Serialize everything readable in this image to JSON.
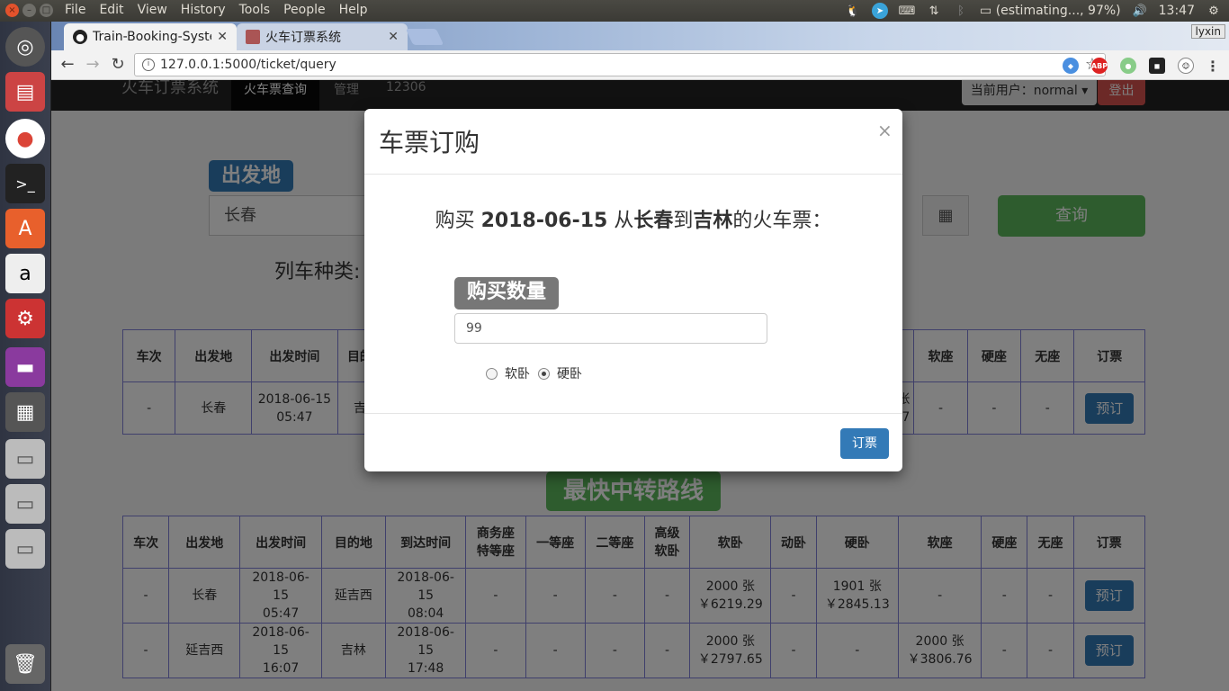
{
  "os": {
    "menu": [
      "File",
      "Edit",
      "View",
      "History",
      "Tools",
      "People",
      "Help"
    ],
    "battery": "(estimating..., 97%)",
    "clock": "13:47"
  },
  "browser": {
    "tabs": [
      {
        "title": "Train-Booking-Syste"
      },
      {
        "title": "火车订票系统"
      }
    ],
    "profile": "lyxin",
    "url": "127.0.0.1:5000/ticket/query"
  },
  "page": {
    "brand": "火车订票系统",
    "nav": {
      "query": "火车票查询",
      "admin": "管理",
      "site12306": "12306"
    },
    "user_label": "当前用户：normal ▾",
    "logout": "登出",
    "depart_label": "出发地",
    "depart_value": "长春",
    "query_btn": "查询",
    "train_type_label": "列车种类:",
    "direct_table": {
      "headers": [
        "车次",
        "出发地",
        "出发时间",
        "目的地",
        "",
        "软座",
        "硬座",
        "无座",
        "订票"
      ],
      "row": {
        "train": "-",
        "from": "长春",
        "date": "2018-06-15",
        "time": "05:47",
        "to": "吉林",
        "partial": "张",
        "partial2": "97",
        "soft_seat": "-",
        "hard_seat": "-",
        "no_seat": "-",
        "book": "预订"
      }
    },
    "transfer_title": "最快中转路线",
    "transfer_table": {
      "headers": [
        "车次",
        "出发地",
        "出发时间",
        "目的地",
        "到达时间",
        "商务座\n特等座",
        "一等座",
        "二等座",
        "高级\n软卧",
        "软卧",
        "动卧",
        "硬卧",
        "软座",
        "硬座",
        "无座",
        "订票"
      ],
      "rows": [
        {
          "train": "-",
          "from": "长春",
          "dep_date": "2018-06-15",
          "dep_time": "05:47",
          "to": "延吉西",
          "arr_date": "2018-06-15",
          "arr_time": "08:04",
          "business": "-",
          "first": "-",
          "second": "-",
          "adv_soft": "-",
          "soft_sleeper_1": "2000 张",
          "soft_sleeper_2": "￥6219.29",
          "dyn_sleeper": "-",
          "hard_sleeper_1": "1901 张",
          "hard_sleeper_2": "￥2845.13",
          "soft_seat_1": "-",
          "soft_seat_2": "",
          "hard_seat": "-",
          "no_seat": "-",
          "book": "预订"
        },
        {
          "train": "-",
          "from": "延吉西",
          "dep_date": "2018-06-15",
          "dep_time": "16:07",
          "to": "吉林",
          "arr_date": "2018-06-15",
          "arr_time": "17:48",
          "business": "-",
          "first": "-",
          "second": "-",
          "adv_soft": "-",
          "soft_sleeper_1": "2000 张",
          "soft_sleeper_2": "￥2797.65",
          "dyn_sleeper": "-",
          "hard_sleeper_1": "-",
          "hard_sleeper_2": "",
          "soft_seat_1": "2000 张",
          "soft_seat_2": "￥3806.76",
          "hard_seat": "-",
          "no_seat": "-",
          "book": "预订"
        }
      ]
    }
  },
  "modal": {
    "title": "车票订购",
    "close": "×",
    "msg_prefix": "购买 ",
    "date": "2018-06-15",
    "msg_from_word": " 从",
    "from": "长春",
    "msg_to_word": "到",
    "to": "吉林",
    "msg_suffix": "的火车票：",
    "qty_label": "购买数量",
    "qty_value": "99",
    "options": [
      {
        "label": "软卧",
        "checked": false
      },
      {
        "label": "硬卧",
        "checked": true
      }
    ],
    "order_btn": "订票"
  }
}
